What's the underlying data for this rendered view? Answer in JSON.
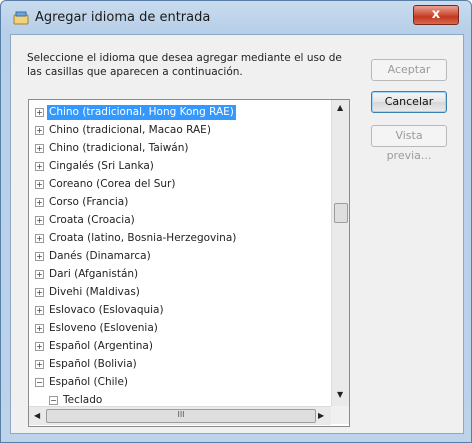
{
  "window": {
    "title": "Agregar idioma de entrada",
    "close_label": "x"
  },
  "instructions": "Seleccione el idioma que desea agregar mediante el uso de las casillas que aparecen a continuación.",
  "buttons": {
    "accept": "Aceptar",
    "cancel": "Cancelar",
    "preview": "Vista previa..."
  },
  "tree": {
    "items": [
      {
        "label": "Chino (tradicional, Hong Kong RAE)",
        "expander": "+",
        "selected": true
      },
      {
        "label": "Chino (tradicional, Macao RAE)",
        "expander": "+"
      },
      {
        "label": "Chino (tradicional, Taiwán)",
        "expander": "+"
      },
      {
        "label": "Cingalés (Sri Lanka)",
        "expander": "+"
      },
      {
        "label": "Coreano (Corea del Sur)",
        "expander": "+"
      },
      {
        "label": "Corso (Francia)",
        "expander": "+"
      },
      {
        "label": "Croata (Croacia)",
        "expander": "+"
      },
      {
        "label": "Croata (latino, Bosnia-Herzegovina)",
        "expander": "+"
      },
      {
        "label": "Danés (Dinamarca)",
        "expander": "+"
      },
      {
        "label": "Dari (Afganistán)",
        "expander": "+"
      },
      {
        "label": "Divehi (Maldivas)",
        "expander": "+"
      },
      {
        "label": "Eslovaco (Eslovaquia)",
        "expander": "+"
      },
      {
        "label": "Esloveno (Eslovenia)",
        "expander": "+"
      },
      {
        "label": "Español (Argentina)",
        "expander": "+"
      },
      {
        "label": "Español (Bolivia)",
        "expander": "+"
      },
      {
        "label": "Español (Chile)",
        "expander": "−"
      },
      {
        "label": "Teclado",
        "expander": "−",
        "child": true
      }
    ],
    "hscroll_grip": "III"
  }
}
